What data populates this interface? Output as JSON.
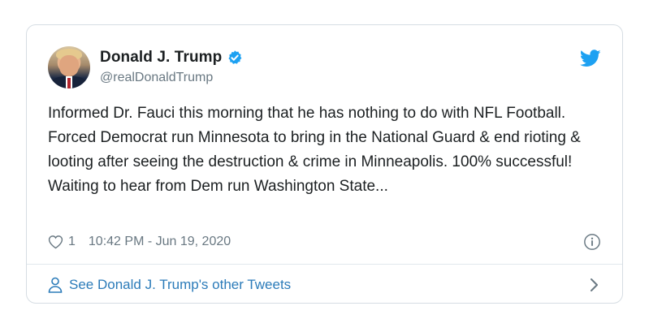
{
  "tweet": {
    "author": {
      "display_name": "Donald J. Trump",
      "handle": "@realDonaldTrump",
      "verified": true
    },
    "text": "Informed Dr. Fauci this morning that he has nothing to do with NFL Football. Forced Democrat run Minnesota to bring in the National Guard & end rioting & looting after seeing the destruction & crime in Minneapolis. 100% successful! Waiting to hear from Dem run Washington State...",
    "likes": "1",
    "timestamp": "10:42 PM - Jun 19, 2020"
  },
  "footer": {
    "link_label": "See Donald J. Trump's other Tweets"
  },
  "icons": {
    "verified": "verified-badge-icon",
    "brand": "twitter-bird-icon",
    "like": "heart-icon",
    "info": "info-icon",
    "person": "person-icon",
    "chevron": "chevron-right-icon"
  },
  "colors": {
    "twitter_blue": "#1da1f2",
    "link_blue": "#2b7bb9",
    "muted_gray": "#697882",
    "text": "#1c2022",
    "border": "#d6dde3"
  }
}
